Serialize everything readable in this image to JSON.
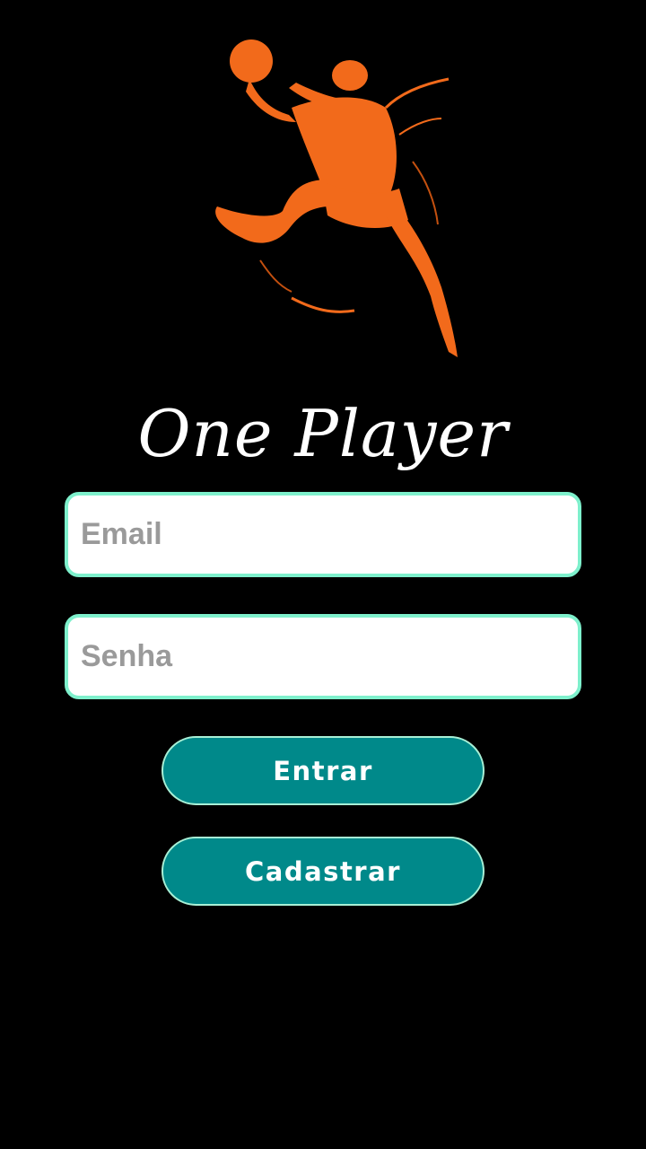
{
  "app": {
    "brand": "One Player",
    "logo_icon": "basketball-player-icon",
    "accent_color": "#00898a",
    "border_color": "#7ef0cc",
    "logo_color": "#f26a1b"
  },
  "login": {
    "email_placeholder": "Email",
    "email_value": "",
    "password_placeholder": "Senha",
    "password_value": "",
    "login_label": "Entrar",
    "register_label": "Cadastrar"
  }
}
